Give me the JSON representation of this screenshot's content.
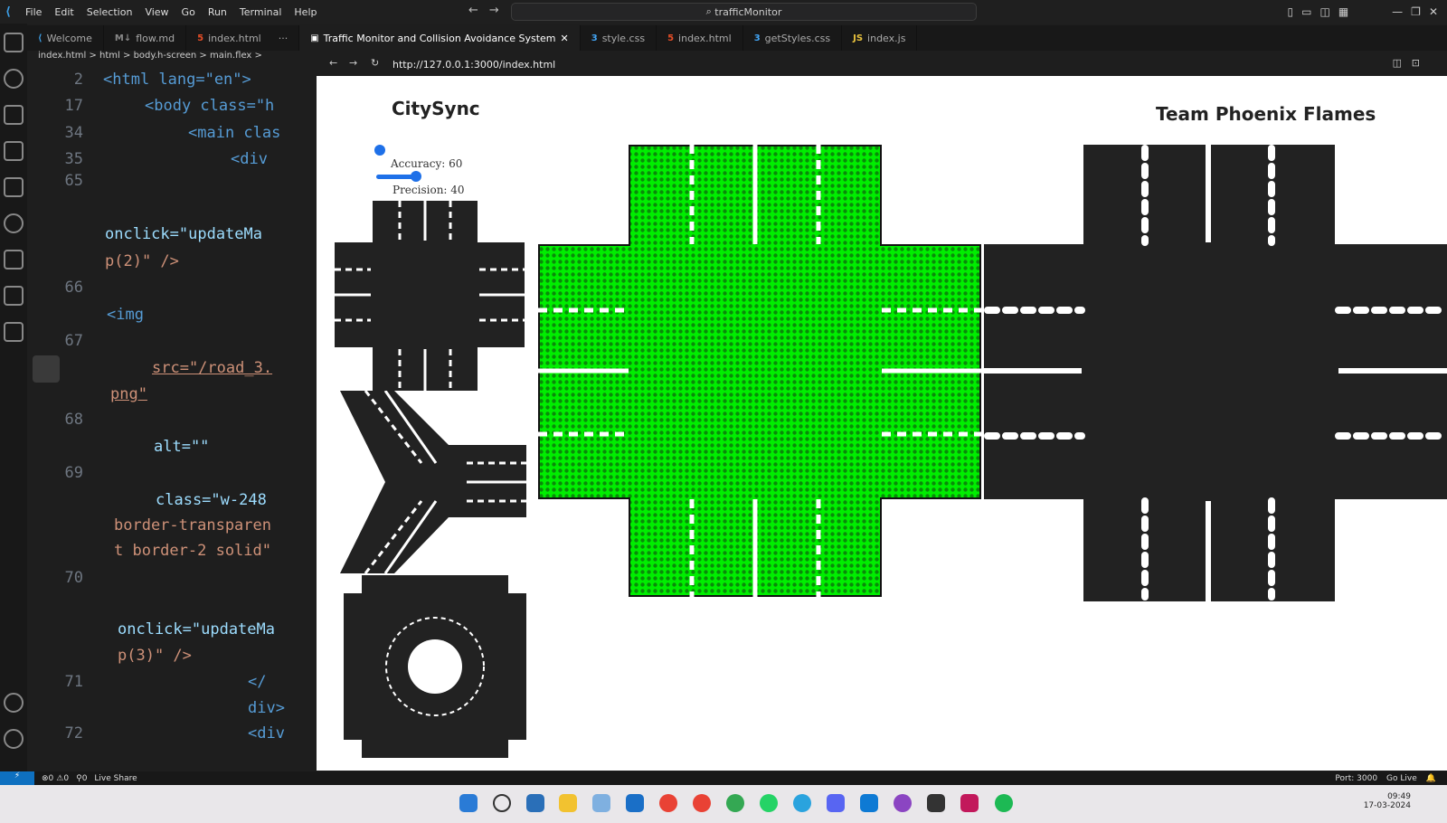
{
  "menu": [
    "File",
    "Edit",
    "Selection",
    "View",
    "Go",
    "Run",
    "Terminal",
    "Help"
  ],
  "command_center": "trafficMonitor",
  "tabs": [
    {
      "label": "Welcome",
      "icon": "vscode-icon",
      "active": false
    },
    {
      "label": "flow.md",
      "icon": "markdown-icon",
      "active": false
    },
    {
      "label": "index.html",
      "icon": "html-icon",
      "active": false
    },
    {
      "label": "Traffic Monitor and Collision Avoidance System",
      "icon": "preview-icon",
      "active": true
    },
    {
      "label": "style.css",
      "icon": "css-icon",
      "active": false
    },
    {
      "label": "index.html",
      "icon": "html-icon",
      "active": false
    },
    {
      "label": "getStyles.css",
      "icon": "css-icon",
      "active": false
    },
    {
      "label": "index.js",
      "icon": "js-icon",
      "active": false
    }
  ],
  "breadcrumb": "index.html > html > body.h-screen > main.flex >",
  "browser": {
    "url": "http://127.0.0.1:3000/index.html"
  },
  "editor": {
    "line_numbers": [
      "2",
      "17",
      "34",
      "35",
      "65",
      "66",
      "67",
      "68",
      "69",
      "70",
      "71",
      "72"
    ],
    "lines": {
      "l2": "<html lang=\"en\">",
      "l17": "<body class=\"h",
      "l34": "<main clas",
      "l35": "<div",
      "l65a": "onclick=\"updateMa",
      "l65b": "p(2)\" />",
      "l66": "<img",
      "l67a": "src=\"/road_3.",
      "l67b": "png\"",
      "l68": "alt=\"\"",
      "l69a": "class=\"w-248",
      "l69b": "border-transparen",
      "l69c": "t border-2 solid\"",
      "l70a": "onclick=\"updateMa",
      "l70b": "p(3)\" />",
      "l71a": "</",
      "l71b": "div>",
      "l72": "<div"
    }
  },
  "app": {
    "brand": "CitySync",
    "team": "Team Phoenix Flames",
    "accuracy_label": "Accuracy: 60",
    "precision_label": "Precision: 40",
    "accuracy": 60,
    "precision": 40
  },
  "status": {
    "errors": "0",
    "warnings": "0",
    "ports_fwd": "0",
    "live_share": "Live Share",
    "port": "Port: 3000",
    "go_live": "Go Live"
  },
  "clock": {
    "time": "09:49",
    "date": "17-03-2024"
  },
  "colors": {
    "highlight": "#00ee00",
    "road": "#222222",
    "accent": "#1e70e8"
  }
}
